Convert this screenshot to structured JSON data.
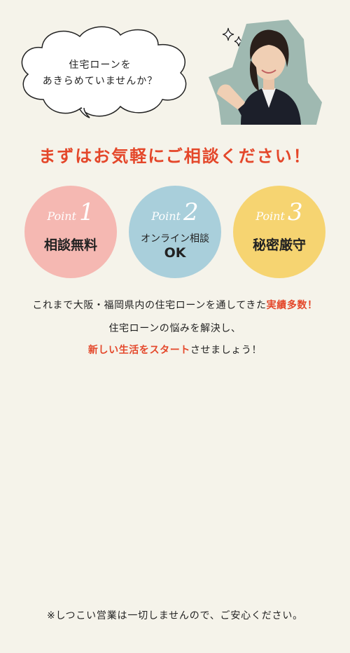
{
  "bubble": {
    "line1": "住宅ローンを",
    "line2": "あきらめていませんか？"
  },
  "headline": "まずはお気軽にご相談ください！",
  "points": [
    {
      "word": "Point",
      "num": "1",
      "title": "相談無料",
      "color": "#f5b8b2"
    },
    {
      "word": "Point",
      "num": "2",
      "title_line1": "オンライン相談",
      "title_line2": "OK",
      "color": "#a9cfdb"
    },
    {
      "word": "Point",
      "num": "3",
      "title": "秘密厳守",
      "color": "#f6d471"
    }
  ],
  "description": {
    "line1_a": "これまで大阪・福岡県内の住宅ローンを通してきた",
    "line1_highlight": "実績多数！",
    "line2": "住宅ローンの悩みを解決し、",
    "line3_highlight": "新しい生活をスタート",
    "line3_b": "させましょう！"
  },
  "note": "※しつこい営業は一切しませんので、ご安心ください。",
  "colors": {
    "accent": "#e4472a",
    "background": "#f5f3ea"
  }
}
